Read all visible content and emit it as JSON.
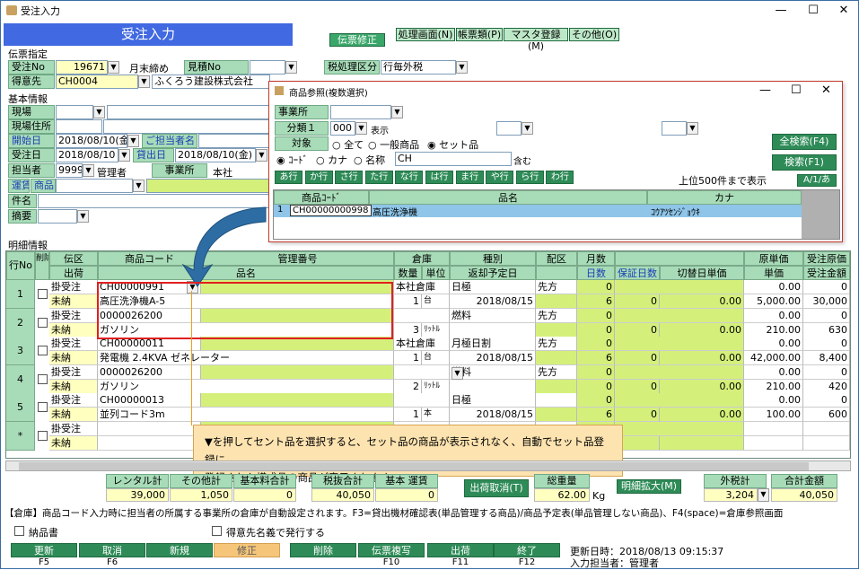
{
  "window": {
    "title": "受注入力",
    "min": "—",
    "max": "☐",
    "close": "✕"
  },
  "header": {
    "title": "受注入力",
    "mode": "伝票修正",
    "menus": [
      "処理画面(N)",
      "帳票類(P)",
      "マスタ登録(M)",
      "その他(O)"
    ]
  },
  "slip": {
    "section": "伝票指定",
    "order_no_label": "受注No",
    "order_no": "19671",
    "closing": "月末締め",
    "estimate_label": "見積No",
    "tax_label": "税処理区分",
    "tax_value": "行毎外税",
    "customer_label": "得意先",
    "customer_code": "CH0004",
    "customer_name": "ふくろう建設株式会社"
  },
  "basic": {
    "section": "基本情報",
    "site": "現場",
    "site_addr": "現場住所",
    "start_label": "開始日",
    "start": "2018/08/10(金)",
    "person_label": "ご担当者名",
    "order_label": "受注日",
    "order_date": "2018/08/10",
    "lend_label": "貸出日",
    "lend_date": "2018/08/10(金)",
    "staff_label": "担当者",
    "staff_code": "9999",
    "staff_name": "管理者",
    "office_label": "事業所",
    "office_name": "本社",
    "transport_label": "運賃",
    "product_label": "商品",
    "subject_label": "件名",
    "summary_label": "摘要"
  },
  "popup": {
    "title": "商品参照(複数選択)",
    "office": "事業所",
    "class1": "分類１",
    "class1_val": "000",
    "show": "表示",
    "target": "対象",
    "opt_all": "全て",
    "opt_general": "一般商品",
    "opt_set": "セット品",
    "opt_code": "ｺｰﾄﾞ",
    "opt_kana": "カナ",
    "opt_name": "名称",
    "search_val": "CH",
    "contains": "含む",
    "all_search": "全検索(F4)",
    "search": "検索(F1)",
    "limit": "上位500件まで表示",
    "kana_btn": "A/1/あ",
    "kana": [
      "あ行",
      "か行",
      "さ行",
      "た行",
      "な行",
      "は行",
      "ま行",
      "や行",
      "ら行",
      "わ行"
    ],
    "cols": [
      "商品ｺｰﾄﾞ",
      "品名",
      "カナ"
    ],
    "row": {
      "no": "1",
      "code": "CH00000000998",
      "name": "高圧洗浄機",
      "kana": "ｺｳｱﾂｾﾝｼﾞｮｳｷ"
    }
  },
  "detail": {
    "section": "明細情報",
    "head1": [
      "行No",
      "削除",
      "伝区",
      "商品コード",
      "管理番号",
      "倉庫",
      "種別",
      "配区",
      "月数",
      "原単価",
      "受注原価"
    ],
    "head2": [
      "出荷",
      "品名",
      "数量",
      "単位",
      "返却予定日",
      "日数",
      "保証日数",
      "切替日単価",
      "単価",
      "受注金額"
    ],
    "rows": [
      {
        "no": "1",
        "kind": "掛受注",
        "ship": "未納",
        "code": "CH00000991",
        "name": "高圧洗浄機A-5",
        "wh": "本社倉庫",
        "qty": "1",
        "unit": "台",
        "type": "日極",
        "ret": "2018/08/15",
        "haiku": "先方",
        "months": "0",
        "days": "6",
        "guarantee": "0",
        "switch": "0.00",
        "cost": "0.00",
        "price": "5,000.00",
        "ocost": "0",
        "amount": "30,000"
      },
      {
        "no": "2",
        "kind": "掛受注",
        "ship": "未納",
        "code": "0000026200",
        "name": "ガソリン",
        "wh": "",
        "qty": "3",
        "unit": "ﾘｯﾄﾙ",
        "type": "燃料",
        "ret": "",
        "haiku": "先方",
        "months": "0",
        "days": "0",
        "guarantee": "0",
        "switch": "0.00",
        "cost": "0.00",
        "price": "210.00",
        "ocost": "0",
        "amount": "630"
      },
      {
        "no": "3",
        "kind": "掛受注",
        "ship": "未納",
        "code": "CH00000011",
        "name": "発電機 2.4KVA ゼネレーター",
        "wh": "本社倉庫",
        "qty": "1",
        "unit": "台",
        "type": "月極日割",
        "ret": "2018/08/15",
        "haiku": "先方",
        "months": "0",
        "days": "6",
        "guarantee": "0",
        "switch": "0.00",
        "cost": "0.00",
        "price": "42,000.00",
        "ocost": "0",
        "amount": "8,400"
      },
      {
        "no": "4",
        "kind": "掛受注",
        "ship": "未納",
        "code": "0000026200",
        "name": "ガソリン",
        "wh": "",
        "qty": "2",
        "unit": "ﾘｯﾄﾙ",
        "type": "燃料",
        "ret": "",
        "haiku": "先方",
        "months": "0",
        "days": "0",
        "guarantee": "0",
        "switch": "0.00",
        "cost": "0.00",
        "price": "210.00",
        "ocost": "0",
        "amount": "420"
      },
      {
        "no": "5",
        "kind": "掛受注",
        "ship": "未納",
        "code": "CH00000013",
        "name": "並列コード3m",
        "wh": "",
        "qty": "1",
        "unit": "本",
        "type": "日極",
        "ret": "2018/08/15",
        "haiku": "",
        "months": "0",
        "days": "6",
        "guarantee": "0",
        "switch": "0.00",
        "cost": "0.00",
        "price": "100.00",
        "ocost": "0",
        "amount": "600"
      },
      {
        "no": "*",
        "kind": "掛受注",
        "ship": "未納",
        "code": "",
        "name": "",
        "wh": "",
        "qty": "",
        "unit": "",
        "type": "",
        "ret": "",
        "haiku": "",
        "months": "",
        "days": "",
        "guarantee": "",
        "switch": "",
        "cost": "",
        "price": "",
        "ocost": "",
        "amount": ""
      }
    ]
  },
  "callout": {
    "line1": "▼を押してセント品を選択すると、セット品の商品が表示されなく、自動でセット品登録に",
    "line2": "登録された構成品の商品が表示されます。"
  },
  "summary": {
    "rental_l": "レンタル計",
    "rental": "39,000",
    "other_l": "その他計",
    "other": "1,050",
    "basic_l": "基本料合計",
    "basic": "0",
    "taxbase_l": "税抜合計",
    "taxbase": "40,050",
    "basefee_l": "基本 運賃",
    "basefee": "0",
    "cancel": "出荷取消(T)",
    "weight_l": "総重量",
    "weight": "62.00",
    "kg": "Kg",
    "expand": "明細拡大(M)",
    "extax_l": "外税計",
    "extax": "3,204",
    "total_l": "合計金額",
    "total": "40,050"
  },
  "status": "【倉庫】商品コード入力時に担当者の所属する事業所の倉庫が自動設定されます。F3=貸出機材確認表(単品管理する商品)/商品予定表(単品管理しない商品)、F4(space)=倉庫参照画面",
  "options": {
    "delivery": "納品書",
    "issue": "得意先名義で発行する"
  },
  "footer": {
    "buttons": [
      "更新",
      "取消",
      "新規",
      "修正",
      "削除",
      "伝票複写",
      "出荷",
      "終了"
    ],
    "keys": [
      "F5",
      "F6",
      "",
      "",
      "",
      "F10",
      "F11",
      "F12"
    ],
    "updated": "更新日時：2018/08/13 09:15:37",
    "inputter": "入力担当者：管理者"
  }
}
